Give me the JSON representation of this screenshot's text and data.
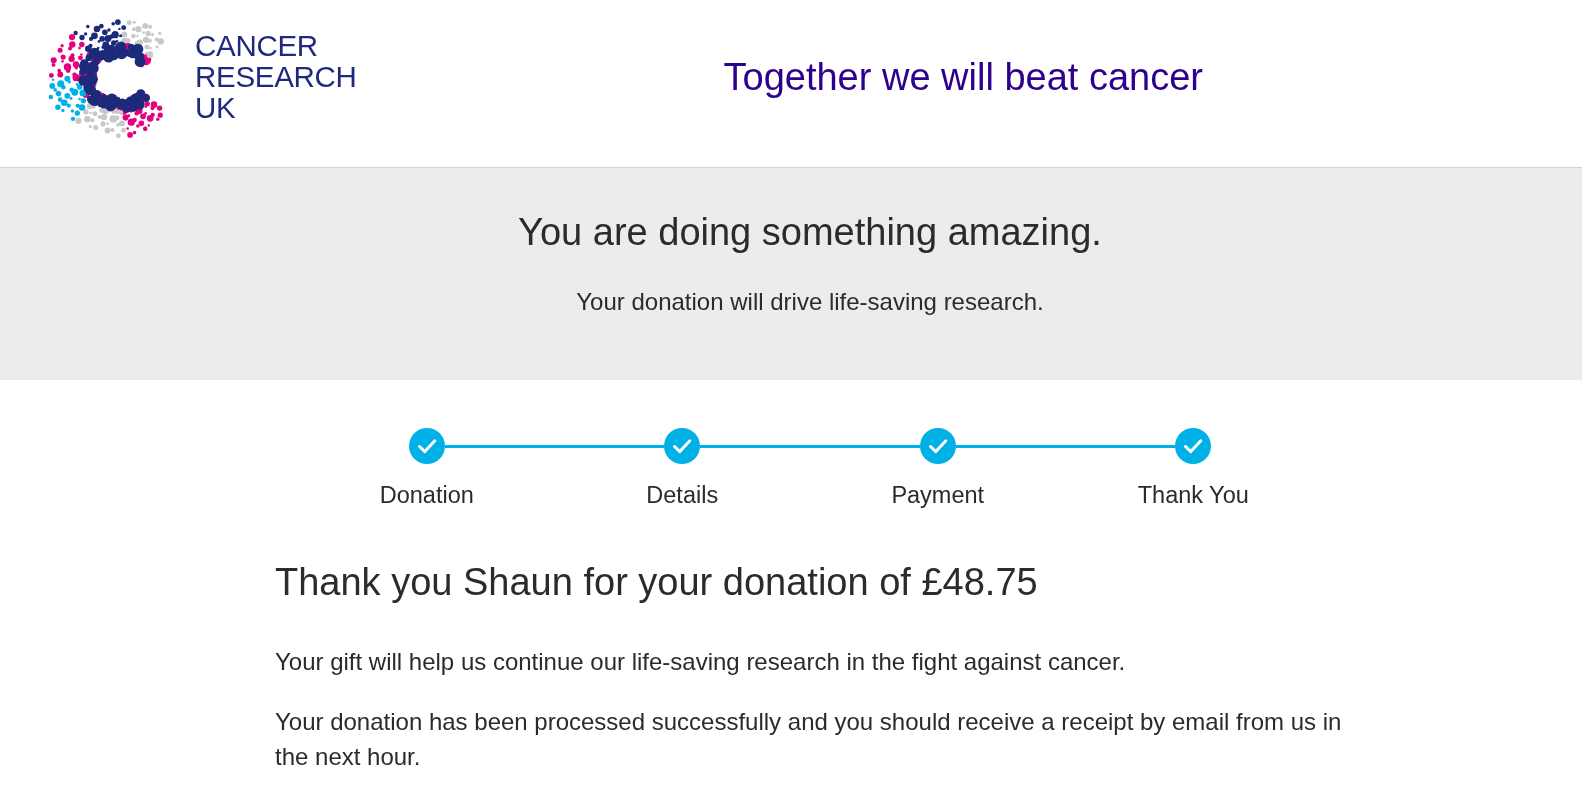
{
  "header": {
    "logo": {
      "lines": [
        "CANCER",
        "RESEARCH",
        "UK"
      ]
    },
    "tagline": "Together we will beat cancer"
  },
  "banner": {
    "title": "You are doing something amazing.",
    "subtitle": "Your donation will drive life-saving research."
  },
  "steps": [
    {
      "label": "Donation",
      "completed": true
    },
    {
      "label": "Details",
      "completed": true
    },
    {
      "label": "Payment",
      "completed": true
    },
    {
      "label": "Thank You",
      "completed": true
    }
  ],
  "confirmation": {
    "title": "Thank you Shaun for your donation of £48.75",
    "paragraphs": [
      "Your gift will help us continue our life-saving research in the fight against cancer.",
      "Your donation has been processed successfully and you should receive a receipt by email from us in the next hour."
    ]
  }
}
